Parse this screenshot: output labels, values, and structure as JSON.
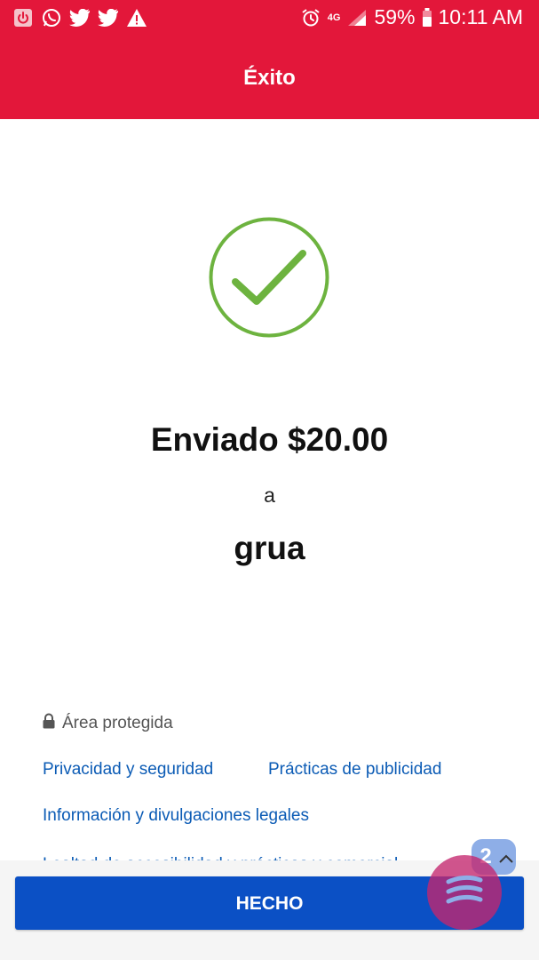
{
  "status_bar": {
    "left_icons": [
      "power-icon",
      "whatsapp-icon",
      "twitter-icon",
      "twitter-icon",
      "warning-icon"
    ],
    "network": "4G",
    "battery": "59%",
    "time": "10:11 AM"
  },
  "header": {
    "title": "Éxito"
  },
  "result": {
    "amount_text": "Enviado $20.00",
    "connector": "a",
    "recipient": "grua"
  },
  "footer": {
    "secure_label": "Área protegida",
    "links": [
      "Privacidad y seguridad",
      "Prácticas de publicidad",
      "Información y divulgaciones legales",
      "Lealtad de accesibilidad y prácticas y comercial"
    ]
  },
  "done_button": {
    "label": "HECHO"
  },
  "chat": {
    "badge": "2"
  },
  "colors": {
    "brand_red": "#e3173a",
    "success_green": "#6db33f",
    "link_blue": "#0b5bb5",
    "button_blue": "#0b50c5"
  }
}
